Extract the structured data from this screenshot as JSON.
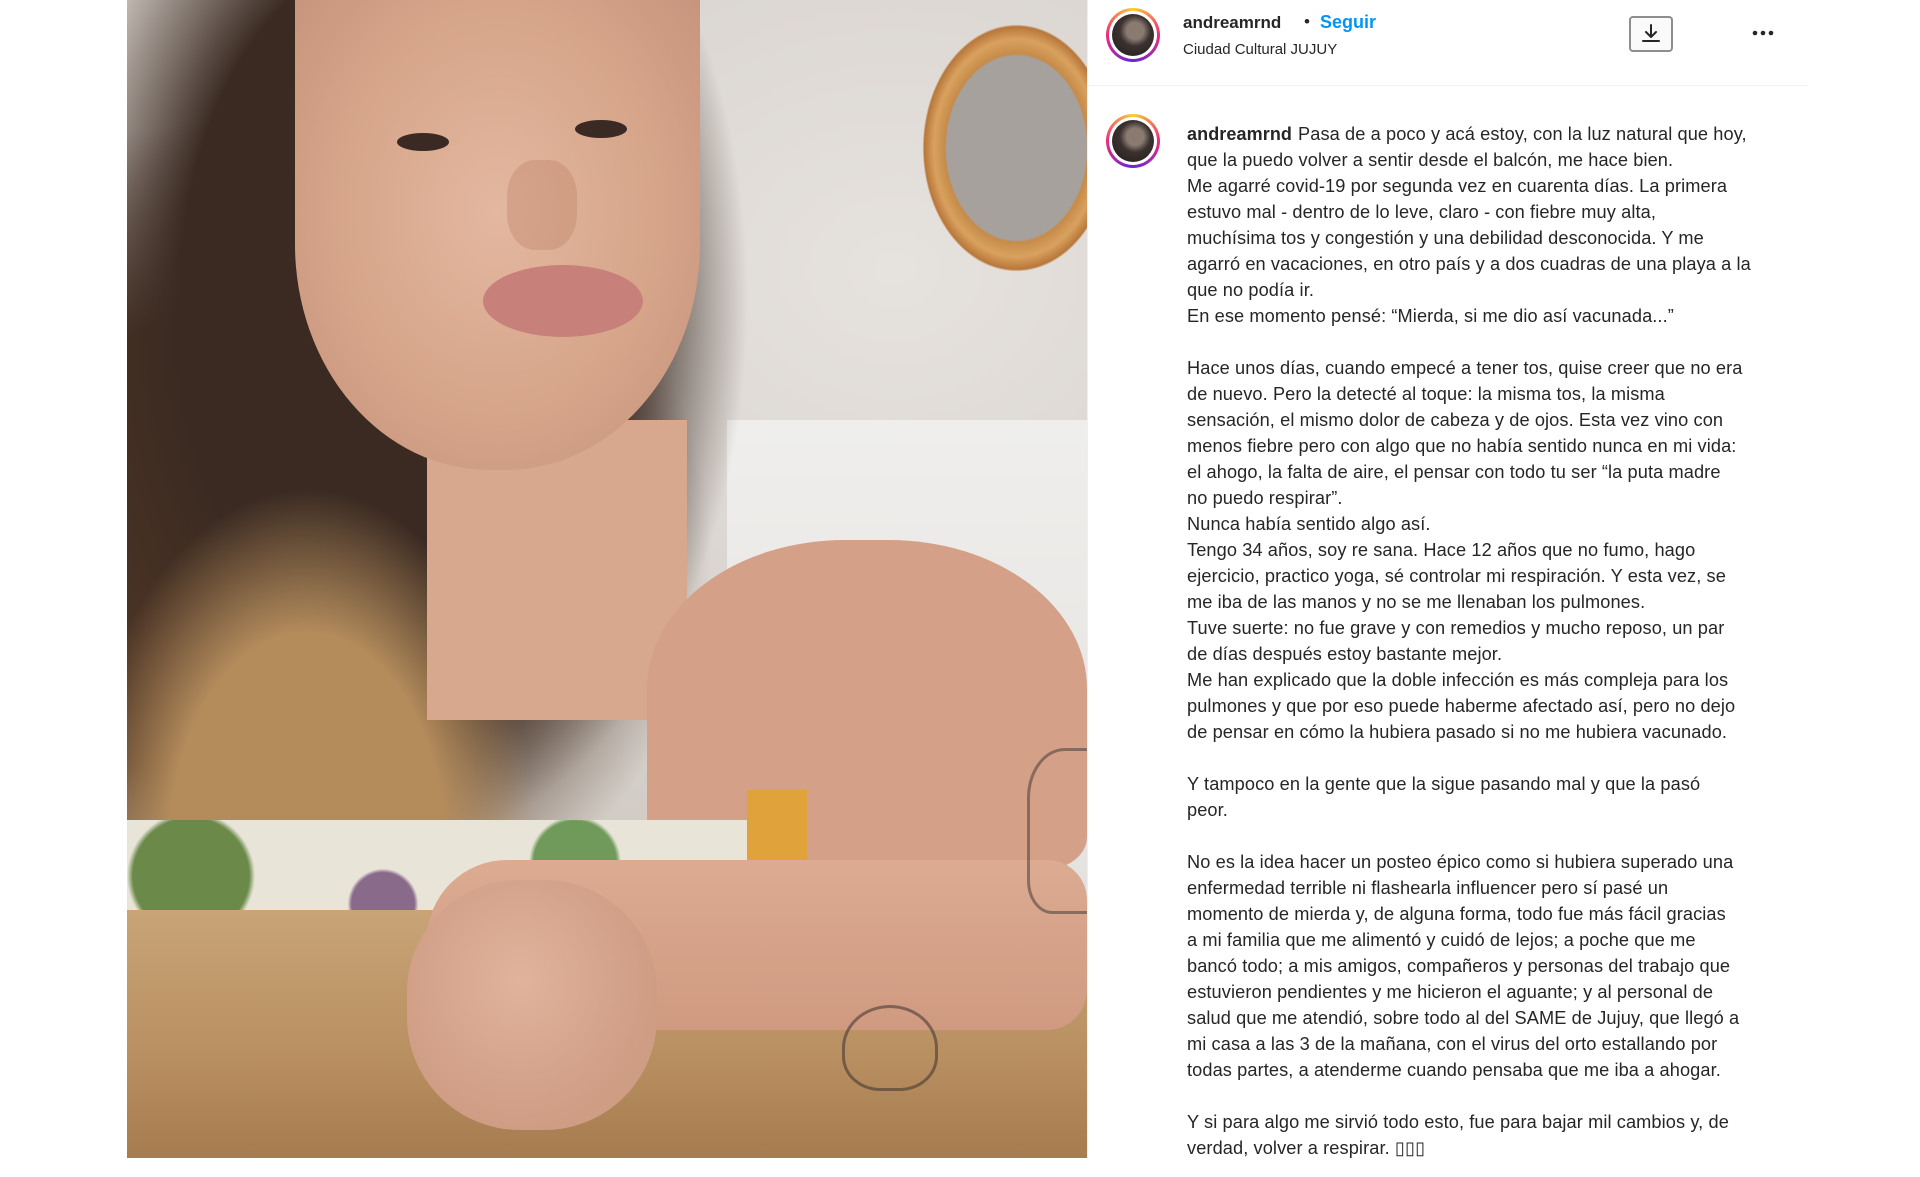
{
  "post": {
    "username": "andreamrnd",
    "separator": "•",
    "follow_label": "Seguir",
    "location": "Ciudad Cultural JUJUY"
  },
  "caption": {
    "username": "andreamrnd",
    "first_line": "Pasa de a poco y acá estoy, con la luz natural que hoy,",
    "lines": [
      "que la puedo volver a sentir desde el balcón, me hace bien.",
      "Me agarré covid-19 por segunda vez en cuarenta días. La primera",
      "estuvo mal - dentro de lo leve, claro - con fiebre muy alta,",
      "muchísima tos y congestión y una debilidad desconocida. Y me",
      "agarró en vacaciones, en otro país y a dos cuadras de una playa a la",
      "que no podía ir.",
      "En ese momento pensé: “Mierda, si me dio así vacunada...”",
      "",
      "Hace unos días, cuando empecé a tener tos, quise creer que no era",
      "de nuevo. Pero la detecté al toque: la misma tos, la misma",
      "sensación, el mismo dolor de cabeza y de ojos. Esta vez vino con",
      "menos fiebre pero con algo que no había sentido nunca en mi vida:",
      "el ahogo, la falta de aire, el pensar con todo tu ser “la puta madre",
      "no puedo respirar”.",
      "Nunca había sentido algo así.",
      "Tengo 34 años, soy re sana. Hace 12 años que no fumo, hago",
      "ejercicio, practico yoga, sé controlar mi respiración. Y esta vez, se",
      "me iba de las manos y no se me llenaban los pulmones.",
      "Tuve suerte: no fue grave y con remedios y mucho reposo, un par",
      "de días después estoy bastante mejor.",
      "Me han explicado que la doble infección es más compleja para los",
      "pulmones y que por eso puede haberme afectado así, pero no dejo",
      "de pensar en cómo la hubiera pasado si no me hubiera vacunado.",
      "",
      "Y tampoco en la gente que la sigue pasando mal y que la pasó",
      "peor.",
      "",
      "No es la idea hacer un posteo épico como si hubiera superado una",
      "enfermedad terrible ni flashearla influencer pero sí pasé un",
      "momento de mierda y, de alguna forma, todo fue más fácil gracias",
      "a mi familia que me alimentó y cuidó de lejos; a poche que me",
      "bancó todo; a mis amigos, compañeros y personas del trabajo que",
      "estuvieron pendientes y me hicieron el aguante; y al personal de",
      "salud que me atendió, sobre todo al del SAME de Jujuy, que llegó a",
      "mi casa a las 3 de la mañana, con el virus del orto estallando por",
      "todas partes, a atenderme cuando pensaba que me iba a ahogar.",
      "",
      "Y si para algo me sirvió todo esto, fue para bajar mil cambios y, de",
      "verdad, volver a respirar. ▯▯▯"
    ]
  },
  "icons": {
    "download": "download-icon",
    "more": "more-options-icon"
  },
  "colors": {
    "link": "#0095f6",
    "text": "#262626",
    "divider": "#efefef"
  }
}
